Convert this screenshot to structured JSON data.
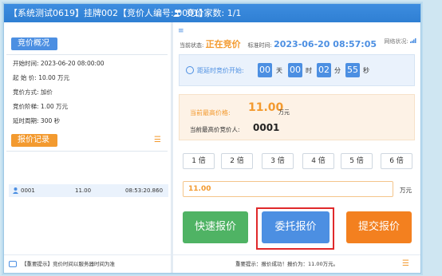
{
  "titlebar": {
    "title": "【系统测试0619】挂牌002【竞价人编号: 0001】",
    "bidders_label": "竞价家数:",
    "bidders_value": "1/1"
  },
  "left_panel": {
    "overview_title": "竞价概况",
    "info": [
      {
        "label": "开始时间:",
        "value": "2023-06-20 08:00:00"
      },
      {
        "label": "起 始 价:",
        "value": "10.00 万元"
      },
      {
        "label": "竞价方式:",
        "value": "加价"
      },
      {
        "label": "竞价阶梯:",
        "value": "1.00 万元"
      },
      {
        "label": "延时周期:",
        "value": "300 秒"
      }
    ],
    "records_title": "报价记录",
    "records": [
      {
        "bidder": "0001",
        "price": "11.00",
        "time": "08:53:20.860"
      }
    ]
  },
  "status_bar": {
    "state_label": "当前状态:",
    "state_value": "正在竞价",
    "time_label": "标准时间:",
    "time_value": "2023-06-20 08:57:05",
    "network_label": "网络状况:"
  },
  "countdown": {
    "label": "距延时竞价开始:",
    "days": "00",
    "days_unit": "天",
    "hours": "00",
    "hours_unit": "时",
    "minutes": "02",
    "minutes_unit": "分",
    "seconds": "55",
    "seconds_unit": "秒"
  },
  "highest": {
    "price_label": "当前最高价格:",
    "price_value": "11.00",
    "price_unit": "万元",
    "bidder_label": "当前最高价竞价人:",
    "bidder_value": "0001"
  },
  "multipliers": [
    "1 倍",
    "2 倍",
    "3 倍",
    "4 倍",
    "5 倍",
    "6 倍"
  ],
  "price_input": {
    "value": "11.00",
    "unit": "万元"
  },
  "buttons": {
    "quick": "快速报价",
    "entrust": "委托报价",
    "submit": "提交报价"
  },
  "footer": {
    "left_hint": "【重要提示】竞价时间以服务器时间为准",
    "right_hint": "重要提示：报价成功！报价为：11.00万元。"
  },
  "colors": {
    "accent": "#4c8fe2",
    "orange": "#f39a2f",
    "green": "#4fb364",
    "highlight": "#e0292b"
  }
}
